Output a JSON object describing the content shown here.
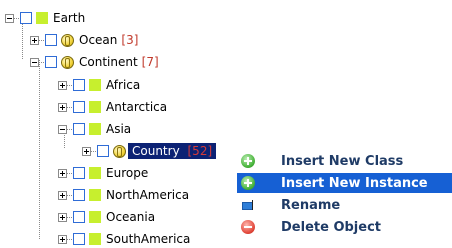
{
  "tree": {
    "root": {
      "label": "Earth"
    },
    "ocean": {
      "label": "Ocean",
      "count": "[3]"
    },
    "continent": {
      "label": "Continent",
      "count": "[7]"
    },
    "africa": {
      "label": "Africa"
    },
    "antarctica": {
      "label": "Antarctica"
    },
    "asia": {
      "label": "Asia"
    },
    "country": {
      "label": "Country",
      "count": "[52]"
    },
    "europe": {
      "label": "Europe"
    },
    "northamerica": {
      "label": "NorthAmerica"
    },
    "oceania": {
      "label": "Oceania"
    },
    "southamerica": {
      "label": "SouthAmerica"
    }
  },
  "context_menu": {
    "items": [
      {
        "label": "Insert New Class",
        "icon": "add-circle-icon"
      },
      {
        "label": "Insert New Instance",
        "icon": "add-circle-icon",
        "highlighted": true
      },
      {
        "label": "Rename",
        "icon": "rename-icon"
      },
      {
        "label": "Delete Object",
        "icon": "delete-circle-icon"
      }
    ]
  },
  "colors": {
    "selection_bg": "#0c2274",
    "menu_highlight": "#1660d4",
    "count_red": "#c0392b",
    "node_square": "#c7ef2e",
    "checkbox_border": "#2f6cd6"
  }
}
